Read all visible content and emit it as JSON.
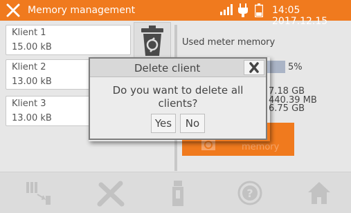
{
  "header": {
    "title": "Memory management",
    "datetime": "14:05 2017.12.15",
    "icons": [
      "tools-icon",
      "signal-icon",
      "plug-icon",
      "battery-icon"
    ],
    "color": "#f07a1e"
  },
  "clients": [
    {
      "name": "Klient 1",
      "size": "15.00 kB"
    },
    {
      "name": "Klient 2",
      "size": "13.00 kB"
    },
    {
      "name": "Klient 3",
      "size": "13.00 kB"
    }
  ],
  "memory": {
    "title": "Used meter memory",
    "percent_label": "5%",
    "percent_value": 0.05,
    "values": [
      "7.18 GB",
      "440.39 MB",
      "6.75 GB"
    ],
    "delete_button_label": "memory"
  },
  "dialog": {
    "title": "Delete client",
    "message_line1": "Do you want to delete all",
    "message_line2": "clients?",
    "yes_label": "Yes",
    "no_label": "No"
  },
  "bottombar": {
    "icons": [
      "sensors-icon",
      "settings-icon",
      "usb-icon",
      "help-icon",
      "home-icon"
    ]
  }
}
